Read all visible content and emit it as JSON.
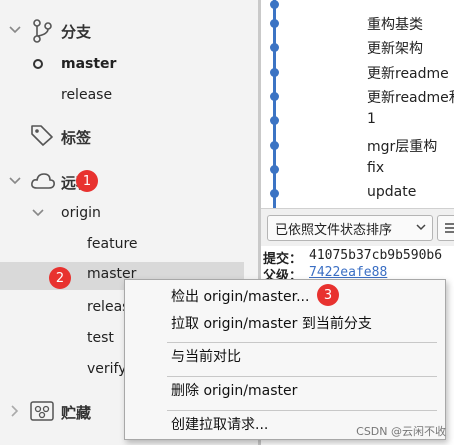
{
  "sidebar": {
    "branches": {
      "title": "分支",
      "items": [
        {
          "label": "master",
          "current": true
        },
        {
          "label": "release"
        }
      ]
    },
    "tags": {
      "title": "标签"
    },
    "remotes": {
      "title": "远程",
      "origin": {
        "label": "origin",
        "items": [
          "feature",
          "master",
          "release",
          "test",
          "verify"
        ]
      }
    },
    "stashes": {
      "title": "贮藏"
    }
  },
  "badges": [
    "1",
    "2",
    "3"
  ],
  "commits": [
    "重构基类",
    "更新架构",
    "更新readme",
    "更新readme和",
    "1",
    "mgr层重构",
    "fix",
    "update"
  ],
  "sort": {
    "label": "已依照文件状态排序"
  },
  "details": {
    "commit_label": "提交：",
    "commit_hash": "41075b37cb9b590b6",
    "parent_label": "父级：",
    "parent_hash": "7422eafe88"
  },
  "context_menu": {
    "items": [
      "检出 origin/master...",
      "拉取 origin/master 到当前分支",
      "与当前对比",
      "删除 origin/master",
      "创建拉取请求..."
    ]
  },
  "watermark": "CSDN @云闲不收",
  "colors": {
    "graph": "#3c74c4",
    "badge": "#e8322f",
    "selection": "#d9d9d9"
  }
}
